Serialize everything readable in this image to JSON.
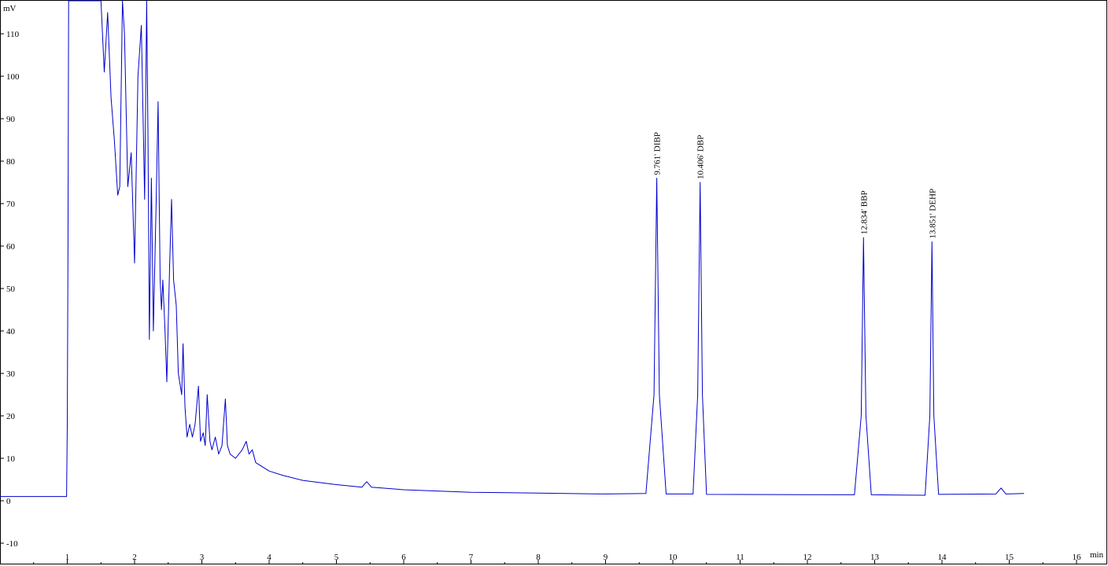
{
  "chart_data": {
    "type": "line",
    "title": "",
    "xlabel": "min",
    "ylabel": "mV",
    "xlim": [
      0,
      16
    ],
    "ylim": [
      -12,
      118
    ],
    "grid": false,
    "colors": {
      "trace": "#0000cc",
      "axis": "#000000"
    },
    "x_ticks": [
      1,
      2,
      3,
      4,
      5,
      6,
      7,
      8,
      9,
      10,
      11,
      12,
      13,
      14,
      15,
      16
    ],
    "y_ticks": [
      -10,
      0,
      10,
      20,
      30,
      40,
      50,
      60,
      70,
      80,
      90,
      100,
      110
    ],
    "series": [
      {
        "name": "",
        "x": [
          0.0,
          0.99,
          1.0,
          1.01,
          1.02,
          1.05,
          1.5,
          1.55,
          1.6,
          1.65,
          1.7,
          1.75,
          1.78,
          1.82,
          1.85,
          1.9,
          1.95,
          2.0,
          2.05,
          2.1,
          2.15,
          2.18,
          2.2,
          2.22,
          2.25,
          2.28,
          2.32,
          2.35,
          2.38,
          2.4,
          2.42,
          2.45,
          2.48,
          2.52,
          2.55,
          2.58,
          2.62,
          2.65,
          2.7,
          2.72,
          2.75,
          2.78,
          2.82,
          2.86,
          2.9,
          2.95,
          2.98,
          3.02,
          3.05,
          3.08,
          3.12,
          3.15,
          3.2,
          3.25,
          3.3,
          3.35,
          3.38,
          3.42,
          3.5,
          3.6,
          3.66,
          3.7,
          3.75,
          3.8,
          3.9,
          4.0,
          4.2,
          4.5,
          5.0,
          5.38,
          5.45,
          5.52,
          6.0,
          7.0,
          8.0,
          9.0,
          9.6,
          9.72,
          9.761,
          9.8,
          9.9,
          10.3,
          10.37,
          10.406,
          10.44,
          10.5,
          12.7,
          12.8,
          12.834,
          12.87,
          12.95,
          13.75,
          13.82,
          13.851,
          13.88,
          13.95,
          14.8,
          14.88,
          14.95,
          15.22
        ],
        "y": [
          1,
          1,
          18,
          60,
          118,
          118,
          118,
          101,
          115,
          95,
          85,
          72,
          74,
          118,
          110,
          74,
          82,
          56,
          100,
          112,
          71,
          118,
          85,
          38,
          76,
          40,
          70,
          94,
          52,
          45,
          52,
          41,
          28,
          55,
          71,
          52,
          46,
          30,
          25,
          37,
          22,
          15,
          18,
          15,
          18,
          27,
          14,
          16,
          13,
          25,
          14,
          12,
          15,
          11,
          13,
          24,
          13,
          11,
          10,
          12,
          14,
          11,
          12,
          9,
          8,
          7,
          6,
          4.8,
          3.8,
          3.2,
          4.5,
          3.2,
          2.6,
          2.0,
          1.8,
          1.6,
          1.7,
          25,
          76,
          25,
          1.6,
          1.6,
          25,
          75,
          25,
          1.5,
          1.4,
          20,
          62,
          20,
          1.4,
          1.3,
          20,
          61,
          20,
          1.5,
          1.6,
          3,
          1.6,
          1.7
        ]
      }
    ],
    "annotations": [
      {
        "time": 9.761,
        "value": 76,
        "text": "9.761'  DIBP"
      },
      {
        "time": 10.406,
        "value": 75,
        "text": "10.406'  DBP"
      },
      {
        "time": 12.834,
        "value": 62,
        "text": "12.834'  BBP"
      },
      {
        "time": 13.851,
        "value": 61,
        "text": "13.851'  DEHP"
      }
    ]
  }
}
